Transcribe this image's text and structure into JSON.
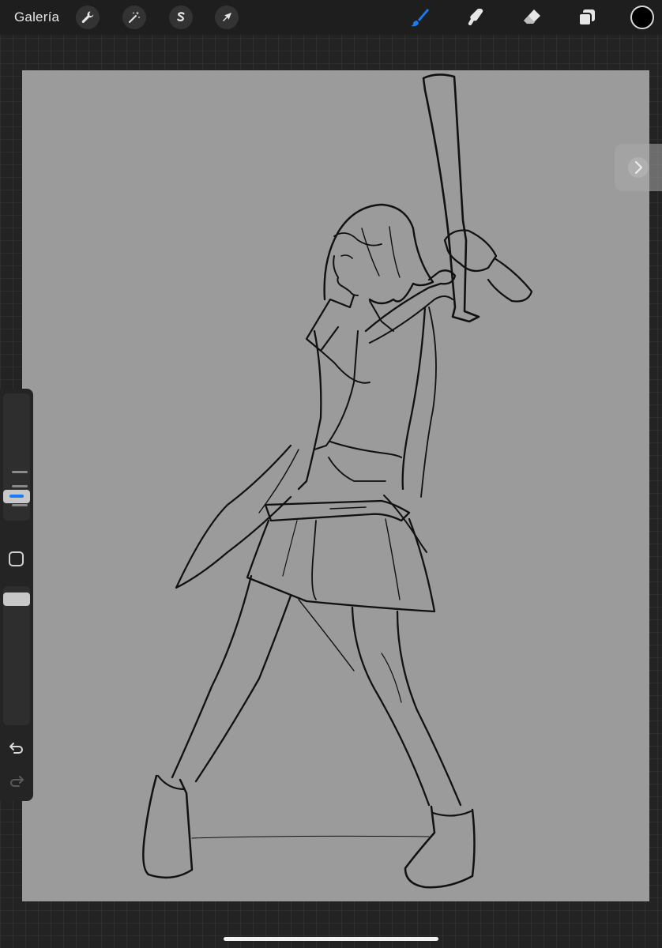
{
  "toolbar": {
    "gallery_label": "Galería",
    "left_tools": [
      {
        "name": "actions",
        "icon": "wrench-icon"
      },
      {
        "name": "adjustments",
        "icon": "magic-wand-icon"
      },
      {
        "name": "selection",
        "icon": "selection-s-icon"
      },
      {
        "name": "transform",
        "icon": "arrow-cursor-icon"
      }
    ],
    "right_tools": [
      {
        "name": "brush",
        "icon": "brush-icon",
        "active": true
      },
      {
        "name": "smudge",
        "icon": "smudge-finger-icon",
        "active": false
      },
      {
        "name": "eraser",
        "icon": "eraser-icon",
        "active": false
      },
      {
        "name": "layers",
        "icon": "layers-icon",
        "active": false
      }
    ],
    "current_color": "#000000",
    "active_color": "#1a7cf5"
  },
  "canvas": {
    "background_color": "#9b9b9b",
    "content": "sketch-line-art"
  },
  "sidebar": {
    "brush_size_level": 0.3,
    "brush_opacity_level": 0.05,
    "modify_icon": "square-icon",
    "undo_icon": "undo-arrow-icon",
    "redo_icon": "redo-arrow-icon"
  },
  "panel_handle_icon": "chevron-right-icon"
}
